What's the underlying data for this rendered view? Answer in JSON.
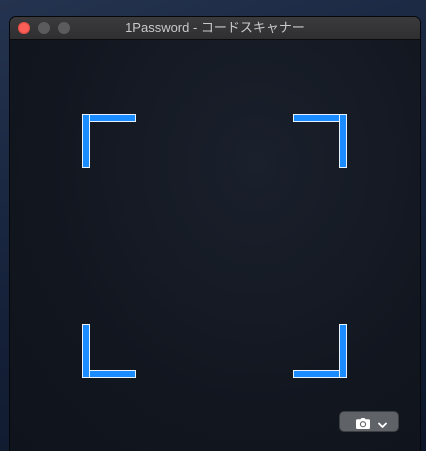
{
  "window": {
    "title": "1Password - コードスキャナー"
  },
  "titlebar": {
    "buttons": [
      "close",
      "minimize",
      "zoom"
    ]
  },
  "scanner": {
    "frame_color": "#1a8cff",
    "corners": [
      "top-left",
      "top-right",
      "bottom-left",
      "bottom-right"
    ]
  },
  "toolbar": {
    "camera_icon": "camera-icon",
    "dropdown_icon": "chevron-down-icon"
  },
  "colors": {
    "close": "#fc5f57",
    "accent": "#1a8cff",
    "window_bg": "#12161f"
  }
}
